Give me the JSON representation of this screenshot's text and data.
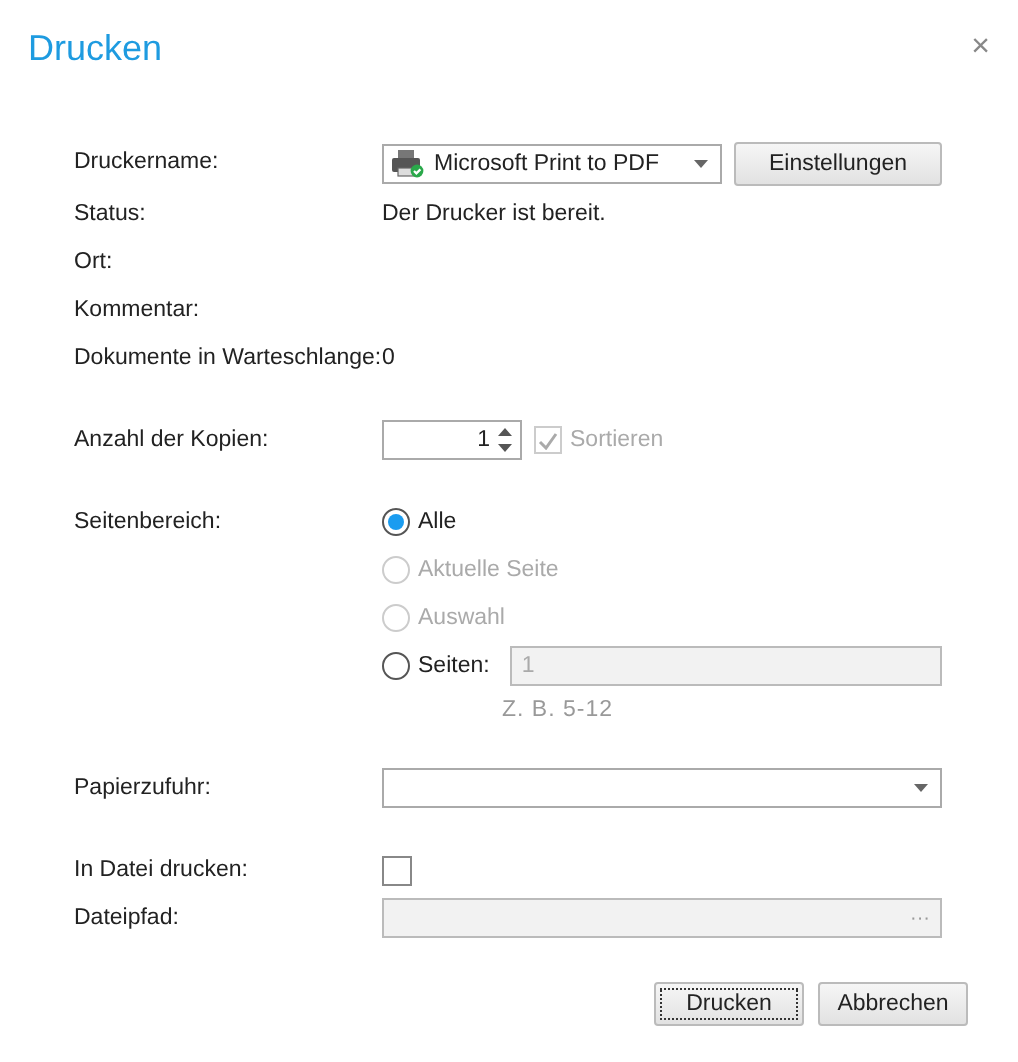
{
  "window": {
    "title": "Drucken",
    "close": "×"
  },
  "printer": {
    "label": "Druckername:",
    "value": "Microsoft Print to PDF",
    "settings_button": "Einstellungen"
  },
  "info": [
    {
      "label": "Status:",
      "value": "Der Drucker ist bereit."
    },
    {
      "label": "Ort:"
    },
    {
      "label": "Kommentar:"
    },
    {
      "label": "Dokumente in Warteschlange:",
      "value": "0"
    }
  ],
  "copies": {
    "label": "Anzahl der Kopien:",
    "value": "1",
    "collate": {
      "label": "Sortieren",
      "checked": true,
      "disabled": true
    }
  },
  "page_range": {
    "label": "Seitenbereich:",
    "options": [
      {
        "label": "Alle",
        "selected": true,
        "disabled": false
      },
      {
        "label": "Aktuelle Seite",
        "selected": false,
        "disabled": true
      },
      {
        "label": "Auswahl",
        "selected": false,
        "disabled": true
      },
      {
        "label": "Seiten:",
        "selected": false,
        "disabled": false
      }
    ],
    "pages_field": {
      "placeholder": "1"
    },
    "hint": "Z. B. 5-12"
  },
  "paper_source": {
    "label": "Papierzufuhr:"
  },
  "print_to_file": {
    "label": "In Datei drucken:",
    "checked": false
  },
  "file_path": {
    "label": "Dateipfad:",
    "browse": "···"
  },
  "buttons": [
    {
      "label": "Drucken",
      "default": true
    },
    {
      "label": "Abbrechen",
      "default": false
    }
  ]
}
